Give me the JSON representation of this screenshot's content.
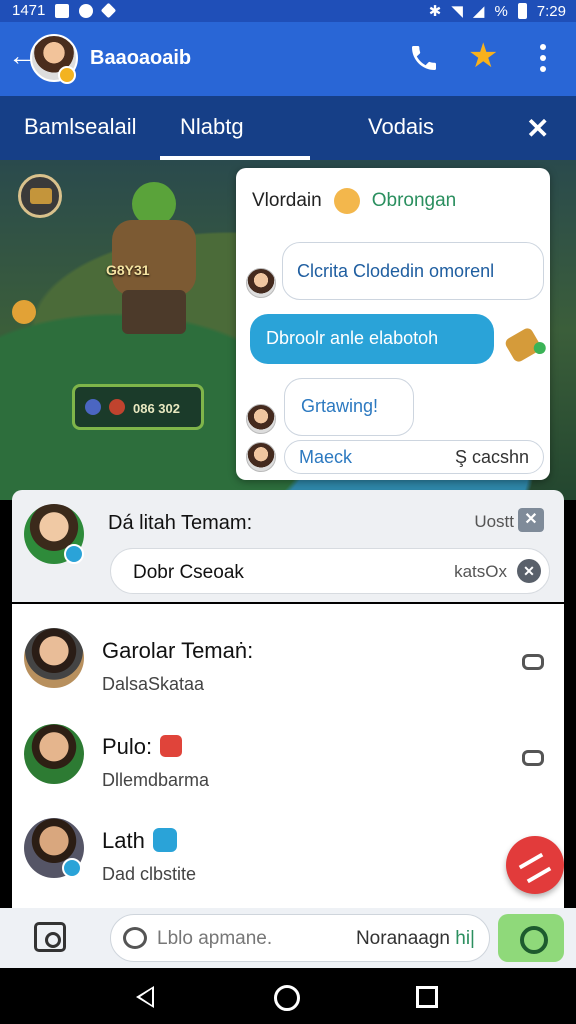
{
  "status_bar": {
    "time_left": "1471",
    "time_right": "7:29",
    "percent": "%"
  },
  "app_bar": {
    "title": "Baaoaoaib"
  },
  "tabs": [
    {
      "label": "Bamlsealail"
    },
    {
      "label": "Nlabtg"
    },
    {
      "label": "Vodais"
    }
  ],
  "scene": {
    "character_label": "G8Y31",
    "hud_text": "086 302"
  },
  "chat": {
    "header_name": "Vlordain",
    "header_name2": "Obrongan",
    "messages": [
      {
        "text": "Clcrita Clodedin omorenl"
      },
      {
        "text": "Dbroolr anle elabotoh"
      },
      {
        "text": "Grtawing!"
      },
      {
        "text": "Maeck",
        "right": "Ş cacshn"
      }
    ]
  },
  "notification": {
    "title": "Dá litah Temam:",
    "meta": "Uostt",
    "sub_label": "Dobr Cseoak",
    "sub_meta": "katsOx"
  },
  "contacts": [
    {
      "name": "Garolar Temaṅ:",
      "sub": "DalsaSkataa"
    },
    {
      "name": "Pulo:",
      "sub": "Dllemdbarma"
    },
    {
      "name": "Lath",
      "sub": "Dad clbstite"
    }
  ],
  "compose": {
    "placeholder": "Lblo apmane.",
    "right_text": "Noranaagn",
    "right_hi": "hi|"
  },
  "colors": {
    "app_bar": "#2966d6",
    "tab_bar": "#163f87",
    "accent": "#2aa3d8",
    "fab": "#e23b3b",
    "send": "#8fd97a"
  }
}
